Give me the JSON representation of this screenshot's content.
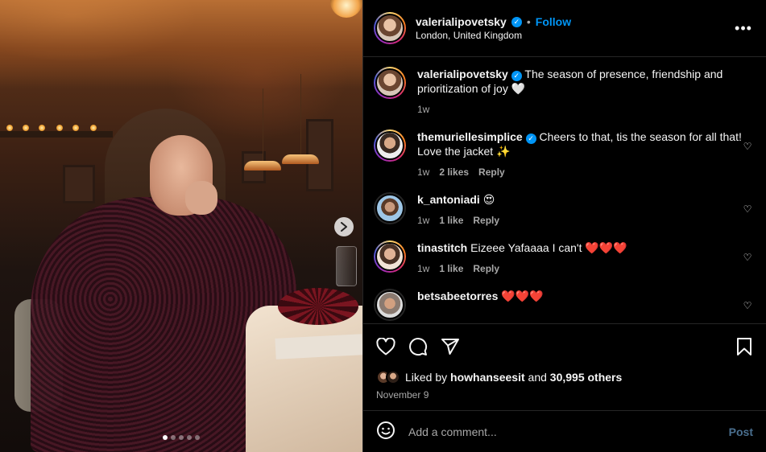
{
  "post": {
    "image": {
      "carousel_dots": 5,
      "active_dot": 1
    },
    "header": {
      "username": "valerialipovetsky",
      "separator": "•",
      "follow_label": "Follow",
      "location": "London, United Kingdom",
      "more_label": "•••"
    },
    "caption": {
      "username": "valerialipovetsky",
      "text": "The season of presence, friendship and prioritization of joy 🤍",
      "time": "1w"
    },
    "comments": [
      {
        "username": "themuriellesimplice",
        "verified": true,
        "text": "Cheers to that, tis the season for all that! Love the jacket ✨",
        "time": "1w",
        "likes": "2 likes",
        "reply_label": "Reply"
      },
      {
        "username": "k_antoniadi",
        "verified": false,
        "text": "😍",
        "time": "1w",
        "likes": "1 like",
        "reply_label": "Reply"
      },
      {
        "username": "tinastitch",
        "verified": false,
        "text": "Eizeee Yafaaaa I can't ❤️❤️❤️",
        "time": "1w",
        "likes": "1 like",
        "reply_label": "Reply"
      },
      {
        "username": "betsabeetorres",
        "verified": false,
        "text": "❤️❤️❤️",
        "time": "",
        "likes": "",
        "reply_label": ""
      }
    ],
    "actions": {
      "like_icon": "heart-icon",
      "comment_icon": "comment-icon",
      "share_icon": "send-icon",
      "save_icon": "bookmark-icon"
    },
    "likes": {
      "prefix": "Liked by",
      "user": "howhanseesit",
      "and": "and",
      "others": "30,995 others"
    },
    "date": "November 9",
    "add_comment": {
      "placeholder": "Add a comment...",
      "post_label": "Post",
      "emoji_icon": "emoji-icon"
    },
    "colors": {
      "background": "#000000",
      "link_blue": "#0095f6",
      "muted": "#a8a8a8",
      "post_disabled": "#4a6f8f"
    }
  }
}
